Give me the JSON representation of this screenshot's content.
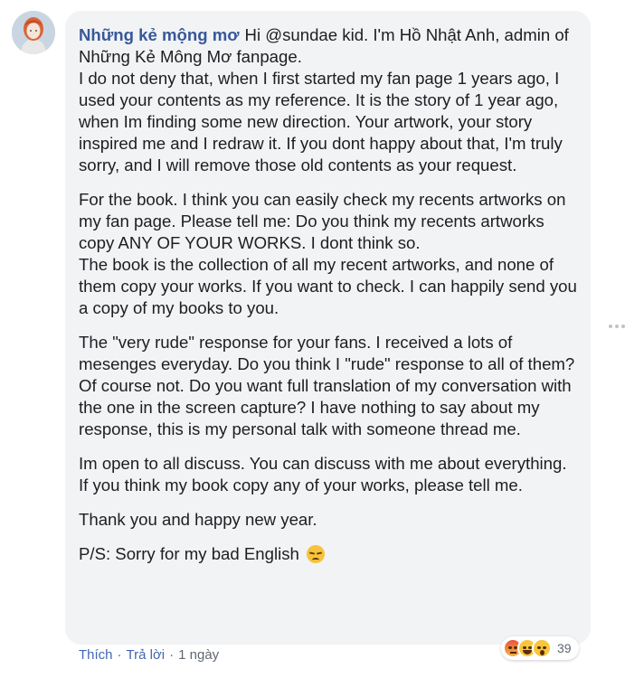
{
  "comment": {
    "author": "Những kẻ mộng mơ",
    "paragraphs": [
      "Hi @sundae kid. I'm Hồ Nhật Anh, admin of Những Kẻ Mông Mơ fanpage.\nI do not deny that, when I first started my fan page 1 years ago, I used your contents as my reference. It is the story of 1 year ago, when Im finding some new direction. Your artwork, your story inspired me and I redraw it. If you dont happy about that, I'm truly sorry, and I will remove those old contents as your request.",
      "For the book. I think you can easily check my recents artworks on my fan page. Please tell me: Do you think my recents artworks copy ANY OF YOUR WORKS. I dont think so.\nThe book is the collection of all my recent artworks, and none of them copy your works. If you want to check. I can happily send you a copy of my books to you.",
      "The \"very rude\" response for your fans. I received a lots of mesenges everyday. Do you think I \"rude\" response to all of them? Of course not. Do you want full translation of my conversation with the one in the screen capture? I have nothing to say about my response, this is my personal talk with someone thread me.",
      "Im open to all discuss. You can discuss with me about everything. If you think my book copy any of your works, please tell me.",
      "Thank you and happy new year.",
      "P/S: Sorry for my bad English"
    ],
    "emoji": "disappointed-face-icon"
  },
  "actions": {
    "like": "Thích",
    "reply": "Trả lời",
    "time": "1 ngày",
    "separator": "·"
  },
  "reactions": {
    "icons": [
      "angry-reaction-icon",
      "haha-reaction-icon",
      "wow-reaction-icon"
    ],
    "count": "39"
  }
}
